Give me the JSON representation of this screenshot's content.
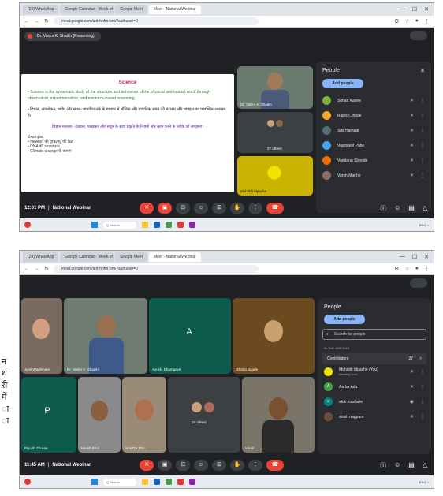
{
  "shot1": {
    "tabs": [
      "(28) WhatsApp",
      "Google Calendar - Week of 9+",
      "Google Meet",
      "Meet - National Webinar"
    ],
    "url": "meet.google.com/ant-hofm-bns?authuser=0",
    "presenter_banner": "Dr. Vasim K. Shaikh (Presenting)",
    "slide": {
      "heading": "Science",
      "line1": "• Science is the systematic study of the structure and behaviour of the physical and natural world through observation, experimentation, and evidence-based reasoning.",
      "line2": "• विज्ञान, अवलोकन, प्रयोग और साक्ष्य-आधारित तर्क के माध्यम से भौतिक और प्राकृतिक जगत की संरचना और व्यवहार का व्यवस्थित अध्ययन है।",
      "line3": "विज्ञान मतलब - देखकर, परखकर और सबूत के साथ प्रकृति के नियमों और काम करने के तरीके को समझना।",
      "example_title": "Example:",
      "examples": [
        "• Newton की gravity की law",
        "• DNA की structure",
        "• Climate change के कारण"
      ]
    },
    "tiles": {
      "presenter_name": "Dr. Vasim K. Shaikh",
      "others": "27 others",
      "self_name": "Mohiddi Idpache"
    },
    "time_title": "12:01 PM",
    "meeting_title": "National Webinar",
    "people_panel": {
      "title": "People",
      "add_label": "Add people",
      "people": [
        "Sohan Kawre",
        "Rajesh Jhode",
        "Sita Hamaal",
        "Vaishnavi Patle",
        "Vandana Shende",
        "Varsh Marthe"
      ]
    }
  },
  "shot2": {
    "tabs": [
      "(28) WhatsApp",
      "Google Calendar - Week of 9+",
      "Google Meet",
      "Meet - National Webinar"
    ],
    "url": "meet.google.com/ant-hofm-bns?authuser=0",
    "tiles": [
      {
        "name": "Jyoti Waghmare"
      },
      {
        "name": "Dr. Vasim K. Shaikh"
      },
      {
        "name": "Ayushi Dhamgaye",
        "initial": "A"
      },
      {
        "name": "Diksha Bagde"
      },
      {
        "name": "Piyush Choure",
        "initial": "P"
      },
      {
        "name": "Nilesh Bhoi"
      },
      {
        "name": "SAVITA ZIN..."
      },
      {
        "name": "18 others"
      },
      {
        "name": "Vinod"
      }
    ],
    "time_title": "11:45 AM",
    "meeting_title": "National Webinar",
    "people_panel": {
      "title": "People",
      "add_label": "Add people",
      "search_placeholder": "Search for people",
      "section": "IN THE MEETING",
      "group": "Contributors",
      "group_count": "27",
      "people": [
        {
          "name": "Mohiddi Idpache (You)",
          "sub": "Meeting host",
          "initial": ""
        },
        {
          "name": "Aarba Ada",
          "initial": "A"
        },
        {
          "name": "alok mashare",
          "initial": "a"
        },
        {
          "name": "anish nagpure",
          "initial": ""
        }
      ]
    }
  },
  "colors": {
    "meet_bg": "#202124",
    "accent_blue": "#8ab4f8",
    "end_red": "#ea4335"
  }
}
